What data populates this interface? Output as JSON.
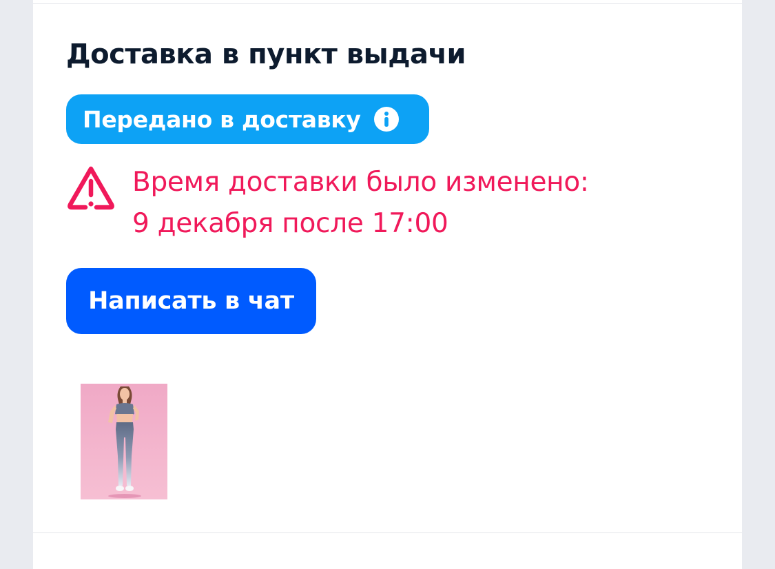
{
  "delivery": {
    "title": "Доставка в пункт выдачи",
    "status_label": "Передано в доставку",
    "status_color": "#0da2f5",
    "warning_line1": "Время доставки было изменено:",
    "warning_line2": "9 декабря после 17:00",
    "warning_color": "#f0195a",
    "chat_button_label": "Написать в чат",
    "chat_button_color": "#005bff",
    "icons": {
      "status_info": "info-icon",
      "warning": "warning-triangle-icon"
    },
    "product_image": "product-thumbnail"
  }
}
